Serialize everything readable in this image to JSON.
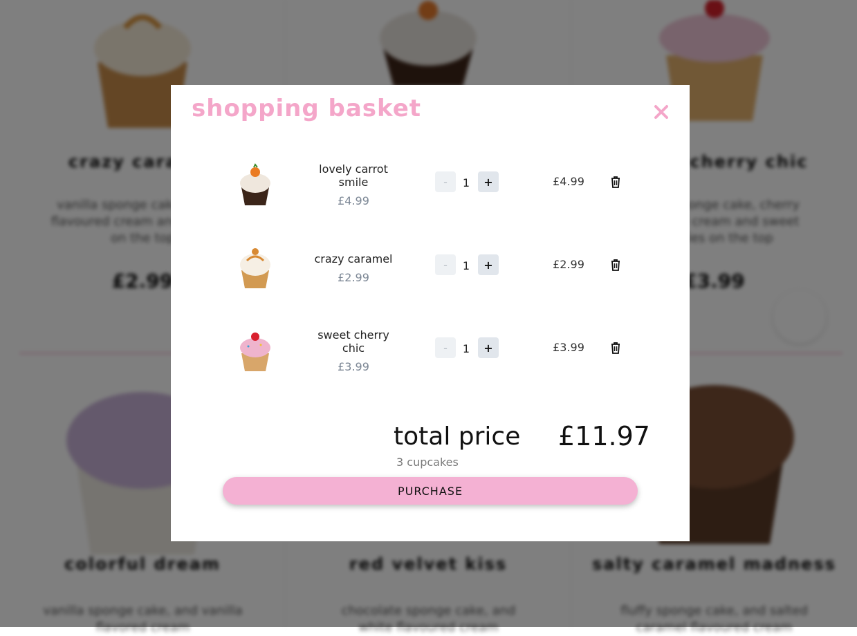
{
  "background": {
    "products": [
      {
        "name": "crazy caramel",
        "desc": "vanilla sponge cake, vanilla flavoured cream and caramel on the top",
        "price": "£2.99"
      },
      {
        "name": "lovely carrot smile",
        "desc": "",
        "price": ""
      },
      {
        "name": "sweet cherry chic",
        "desc": "vanilla sponge cake, cherry flavoured cream and sweet cherries on the top",
        "price": "£3.99"
      },
      {
        "name": "colorful dream",
        "desc": "vanilla sponge cake, and vanilla flavored cream",
        "price": ""
      },
      {
        "name": "red velvet kiss",
        "desc": "chocolate sponge cake, and white flavoured cream",
        "price": ""
      },
      {
        "name": "salty caramel madness",
        "desc": "fluffy sponge cake, and salted caramel flavoured cream",
        "price": ""
      }
    ]
  },
  "modal": {
    "title": "shopping basket",
    "close_icon": "close-icon",
    "items": [
      {
        "name_line1": "lovely carrot",
        "name_line2": "smile",
        "unit_price": "£4.99",
        "minus": "-",
        "qty": "1",
        "plus": "+",
        "line_total": "£4.99"
      },
      {
        "name_line1": "crazy caramel",
        "name_line2": "",
        "unit_price": "£2.99",
        "minus": "-",
        "qty": "1",
        "plus": "+",
        "line_total": "£2.99"
      },
      {
        "name_line1": "sweet cherry",
        "name_line2": "chic",
        "unit_price": "£3.99",
        "minus": "-",
        "qty": "1",
        "plus": "+",
        "line_total": "£3.99"
      }
    ],
    "total_label": "total price",
    "total_value": "£11.97",
    "total_count": "3 cupcakes",
    "purchase_label": "PURCHASE"
  },
  "colors": {
    "brand_pink": "#f4a6c9",
    "button_pink": "#f4b1d3",
    "overlay": "rgba(0,0,0,0.5)"
  }
}
